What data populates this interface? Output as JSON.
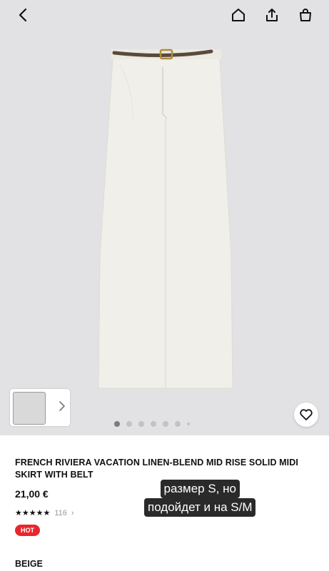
{
  "icons": {
    "back": "chevron-left-icon",
    "home": "home-icon",
    "share": "share-icon",
    "bag": "shopping-bag-icon",
    "favorite": "heart-icon",
    "thumb_next": "chevron-right-icon"
  },
  "gallery": {
    "total_dots": 7,
    "active_index": 0
  },
  "product": {
    "title": "FRENCH RIVIERA VACATION LINEN-BLEND MID RISE SOLID MIDI SKIRT WITH BELT",
    "price": "21,00 €",
    "stars": "★★★★★",
    "review_count": "116",
    "review_chevron": "›",
    "badge": "HOT",
    "color": "BEIGE"
  },
  "overlay": {
    "line1": "размер S, но",
    "line2": "подойдет и на S/M"
  },
  "colors": {
    "accent": "#e8262e",
    "hero_bg": "#e2e2e4"
  }
}
